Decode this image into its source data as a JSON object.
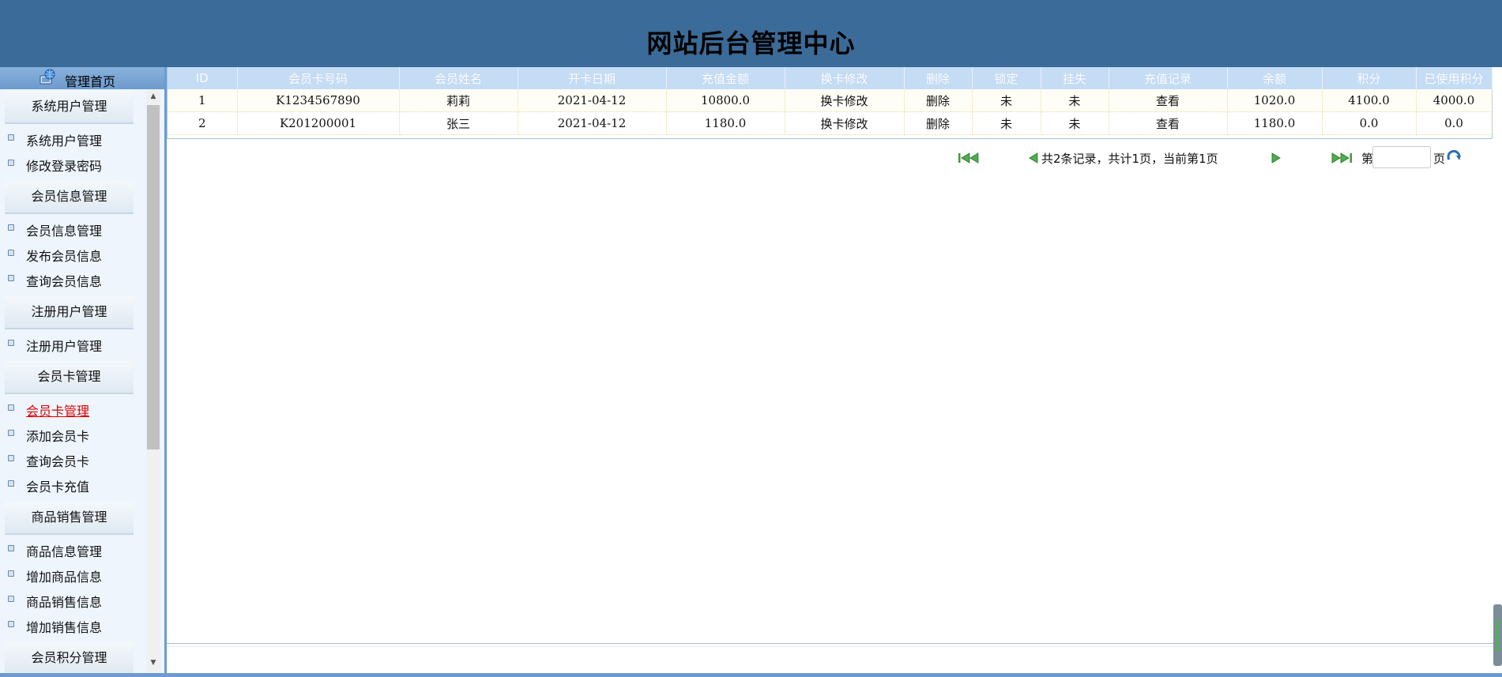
{
  "header": {
    "title": "网站后台管理中心"
  },
  "sidebar": {
    "home_label": "管理首页",
    "sections": [
      {
        "title": "系统用户管理",
        "items": [
          {
            "label": "系统用户管理"
          },
          {
            "label": "修改登录密码"
          }
        ]
      },
      {
        "title": "会员信息管理",
        "items": [
          {
            "label": "会员信息管理"
          },
          {
            "label": "发布会员信息"
          },
          {
            "label": "查询会员信息"
          }
        ]
      },
      {
        "title": "注册用户管理",
        "items": [
          {
            "label": "注册用户管理"
          }
        ]
      },
      {
        "title": "会员卡管理",
        "items": [
          {
            "label": "会员卡管理",
            "active": true
          },
          {
            "label": "添加会员卡"
          },
          {
            "label": "查询会员卡"
          },
          {
            "label": "会员卡充值"
          }
        ]
      },
      {
        "title": "商品销售管理",
        "items": [
          {
            "label": "商品信息管理"
          },
          {
            "label": "增加商品信息"
          },
          {
            "label": "商品销售信息"
          },
          {
            "label": "增加销售信息"
          }
        ]
      },
      {
        "title": "会员积分管理",
        "items": []
      }
    ]
  },
  "table": {
    "columns": [
      "ID",
      "会员卡号码",
      "会员姓名",
      "开卡日期",
      "充值金额",
      "换卡修改",
      "删除",
      "锁定",
      "挂失",
      "充值记录",
      "余额",
      "积分",
      "已使用积分"
    ],
    "rows": [
      [
        "1",
        "K1234567890",
        "莉莉",
        "2021-04-12",
        "10800.0",
        "换卡修改",
        "删除",
        "未",
        "未",
        "查看",
        "1020.0",
        "4100.0",
        "4000.0"
      ],
      [
        "2",
        "K201200001",
        "张三",
        "2021-04-12",
        "1180.0",
        "换卡修改",
        "删除",
        "未",
        "未",
        "查看",
        "1180.0",
        "0.0",
        "0.0"
      ]
    ]
  },
  "pager": {
    "info": "共2条记录，共计1页，当前第1页",
    "prefix": "第",
    "suffix": "页",
    "page_input_value": "",
    "icons": {
      "first": "first-page-icon",
      "prev": "prev-page-icon",
      "next": "next-page-icon",
      "last": "last-page-icon",
      "go": "go-refresh-icon"
    }
  },
  "colors": {
    "header_bg": "#3b6b98",
    "sidebar_bg": "#eef5fd",
    "table_header_bg": "#c5dcf5",
    "active_link": "#e00000",
    "pager_arrow": "#3c9a3c"
  }
}
